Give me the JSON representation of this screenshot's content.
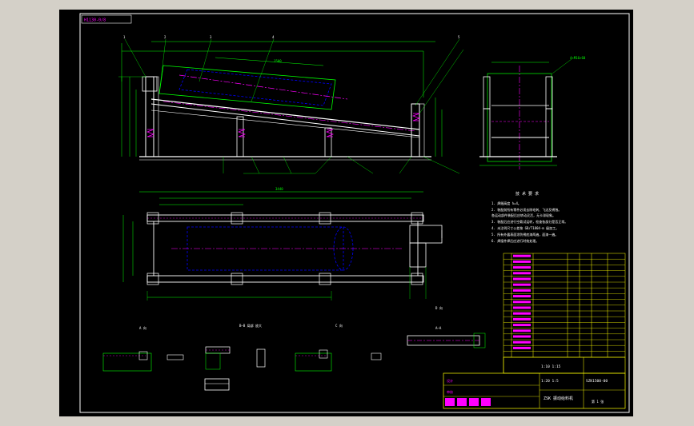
{
  "drawing": {
    "corner_stamp": "H1130-0/8",
    "plan_dimension": "3440",
    "tech_heading": "技 术 要 求",
    "tech_lines": [
      "1. 焊缝高度 h=4。",
      "2. 装配前所有零件必须去除毛刺、飞边及锈蚀。",
      "   各运动部件装配后应转动灵活，无卡滞现象。",
      "3. 装配后应进行空载试运转，检查各部分是否正常。",
      "4. 未注明尺寸公差按 GB/T1804-m 级加工。",
      "5. 所有外露表面涂防锈底漆两遍，面漆一遍。",
      "6. 焊接件焊后应进行时效处理。"
    ],
    "view_labels": [
      "A 向",
      "B—B 局部 放大",
      "C 向",
      "D 向",
      "A—A"
    ],
    "title_block": {
      "scale_line1": "1:10  1:15",
      "scale_line2": "1:20  1:5",
      "drawing_no": "SZK1500-00",
      "title": "ZSK 振动给料机",
      "sheet": "第 1 张",
      "designer": "设计",
      "checker": "审核"
    }
  },
  "colors": {
    "background": "#000000",
    "frame": "#ffffff",
    "dimension": "#00ff00",
    "hidden": "#0000ff",
    "center": "#ff00ff",
    "table": "#ffff00",
    "note": "#ffffff"
  }
}
